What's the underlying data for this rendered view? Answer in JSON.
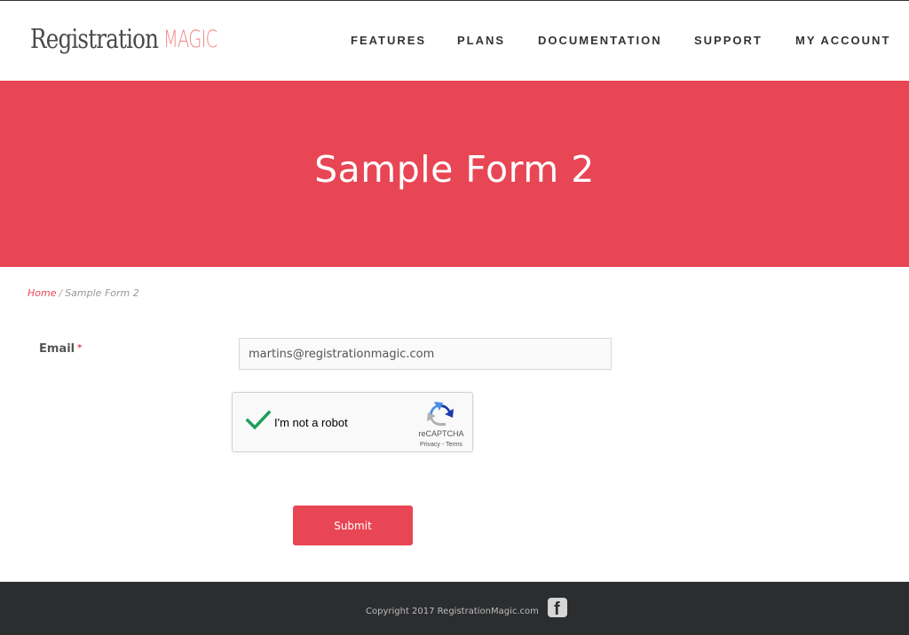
{
  "logo": {
    "main": "Registration",
    "accent": "MAGIC"
  },
  "nav": {
    "items": [
      {
        "label": "FEATURES"
      },
      {
        "label": "PLANS"
      },
      {
        "label": "DOCUMENTATION"
      },
      {
        "label": "SUPPORT"
      },
      {
        "label": "MY ACCOUNT"
      }
    ]
  },
  "hero": {
    "title": "Sample Form 2"
  },
  "breadcrumb": {
    "home": "Home",
    "separator": "/",
    "current": "Sample Form 2"
  },
  "form": {
    "email_label": "Email",
    "required_mark": "*",
    "email_value": "martins@registrationmagic.com",
    "recaptcha": {
      "label": "I'm not a robot",
      "checked": true,
      "brand": "reCAPTCHA",
      "privacy": "Privacy",
      "links_sep": " - ",
      "terms": "Terms"
    },
    "submit_label": "Submit"
  },
  "footer": {
    "copyright": "Copyright 2017 RegistrationMagic.com",
    "social_icon": "facebook-icon"
  },
  "colors": {
    "brand": "#e84655",
    "footer_bg": "#2c2d2f",
    "check": "#1e9e5a"
  }
}
